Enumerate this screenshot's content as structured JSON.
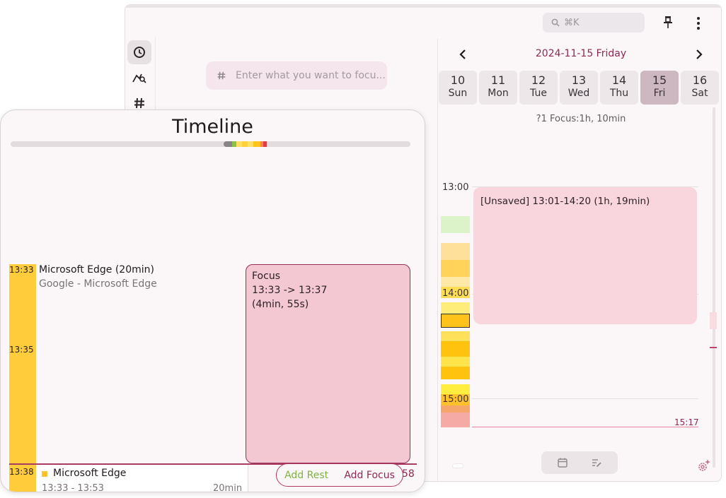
{
  "header": {
    "search_placeholder": "⌘K",
    "icons": [
      "search-icon",
      "pin-icon",
      "more-vert-icon"
    ]
  },
  "nav": {
    "items": [
      {
        "name": "clock-icon",
        "active": true
      },
      {
        "name": "chart-search-icon",
        "active": false
      },
      {
        "name": "hashtag-icon",
        "active": false
      }
    ]
  },
  "task_input": {
    "placeholder": "Enter what you want to focu..."
  },
  "calendar": {
    "date_title": "2024-11-15 Friday",
    "days": [
      {
        "num": "10",
        "name": "Sun",
        "active": false
      },
      {
        "num": "11",
        "name": "Mon",
        "active": false
      },
      {
        "num": "12",
        "name": "Tue",
        "active": false
      },
      {
        "num": "13",
        "name": "Wed",
        "active": false
      },
      {
        "num": "14",
        "name": "Thu",
        "active": false
      },
      {
        "num": "15",
        "name": "Fri",
        "active": true
      },
      {
        "num": "16",
        "name": "Sat",
        "active": false
      }
    ],
    "summary": "?1   Focus:1h, 10min",
    "hours": [
      "13:00",
      "14:00",
      "15:00"
    ],
    "event": "[Unsaved] 13:01-14:20 (1h, 19min)",
    "now_label": "15:17",
    "colors": {
      "accent": "#8e2852",
      "event_bg": "#f9d5de",
      "now_line": "#e7849f"
    }
  },
  "timeline": {
    "title": "Timeline",
    "times": [
      "13:33",
      "13:35",
      "13:38"
    ],
    "app": {
      "name": "Microsoft Edge (20min)",
      "subtitle": "Google - Microsoft Edge"
    },
    "focus": {
      "title": "Focus",
      "range": "13:33 -> 13:37",
      "duration": "(4min, 55s)"
    },
    "card": {
      "title": "Microsoft Edge",
      "time": "13:33 - 13:53",
      "duration": "20min"
    },
    "actions": {
      "add_rest": "Add Rest",
      "add_focus": "Add Focus"
    },
    "right_number": "58",
    "colors": {
      "app_bar": "#ffcc3c",
      "focus_bg": "#f3c8d3",
      "focus_border": "#9a2f57",
      "add_rest": "#7cb342"
    }
  }
}
